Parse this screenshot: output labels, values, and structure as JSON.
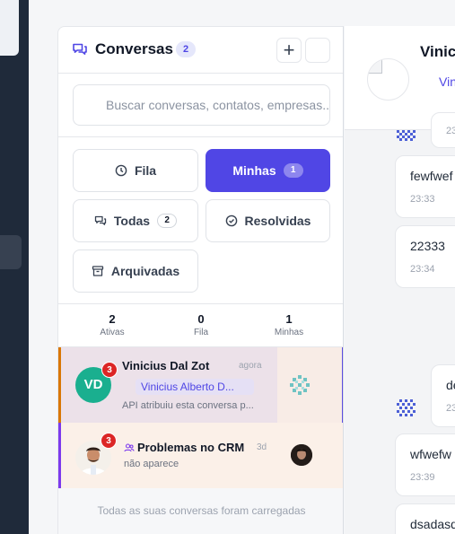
{
  "sidebar_header": {
    "title": "Conversas",
    "count": "2",
    "add_label": "+"
  },
  "search": {
    "placeholder": "Buscar conversas, contatos, empresas..."
  },
  "filters": {
    "fila": {
      "label": "Fila"
    },
    "minhas": {
      "label": "Minhas",
      "count": "1"
    },
    "todas": {
      "label": "Todas",
      "count": "2"
    },
    "resolvidas": {
      "label": "Resolvidas"
    },
    "arquivadas": {
      "label": "Arquivadas"
    }
  },
  "stats": [
    {
      "value": "2",
      "label": "Ativas"
    },
    {
      "value": "0",
      "label": "Fila"
    },
    {
      "value": "1",
      "label": "Minhas"
    }
  ],
  "conversations": [
    {
      "initials": "VD",
      "unread": "3",
      "name": "Vinicius Dal Zot",
      "time": "agora",
      "agent": "Vinicius Alberto D...",
      "preview": "API atribuiu esta conversa p...",
      "accent_color": "#d97706",
      "avatar_color": "#1aaf8f"
    },
    {
      "unread": "3",
      "name": "Problemas no CRM",
      "time": "3d",
      "preview": "não aparece",
      "accent_color": "#7c3aed",
      "group_icon": "group-icon"
    }
  ],
  "footer": "Todas as suas conversas foram carregadas",
  "chat": {
    "name": "Vinic",
    "subtitle": "Vin",
    "messages": [
      {
        "text": "",
        "time": "23"
      },
      {
        "text": "fewfwef",
        "time": "23:33"
      },
      {
        "text": "22333",
        "time": "23:34"
      },
      {
        "text": "de",
        "time": "23"
      },
      {
        "text": "wfwefw",
        "time": "23:39"
      },
      {
        "text": "dsadasd",
        "time": ""
      }
    ]
  },
  "colors": {
    "primary": "#5046e5",
    "rail": "#1f2a3a",
    "unread_badge": "#dc2626"
  }
}
